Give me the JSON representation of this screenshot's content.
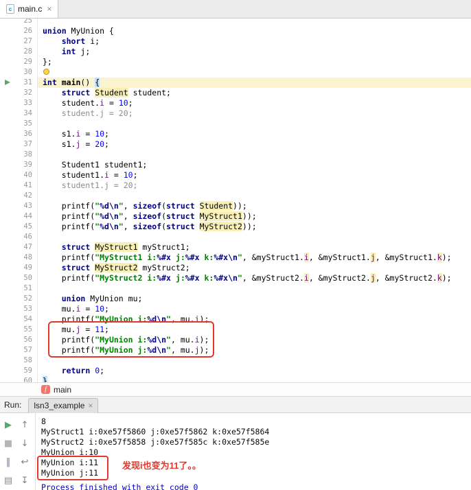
{
  "editor_tab": {
    "title": "main.c",
    "close": "×",
    "icon_letter": "c"
  },
  "breadcrumb": {
    "icon_letter": "f",
    "label": "main"
  },
  "colors": {
    "keyword": "#000080",
    "string": "#008000",
    "number": "#0000FF",
    "field": "#660E7A",
    "identifier_highlight": "#F7EFB6",
    "current_line": "#FCF3CF",
    "annotation_red": "#E3362C",
    "process_line_blue": "#0000CC",
    "run_green": "#59A869"
  },
  "editor": {
    "lines": [
      {
        "n": 25,
        "tokens": []
      },
      {
        "n": 26,
        "tokens": [
          [
            "k",
            "union"
          ],
          [
            "p",
            " MyUnion {"
          ]
        ]
      },
      {
        "n": 27,
        "tokens": [
          [
            "p",
            "    "
          ],
          [
            "k",
            "short"
          ],
          [
            "p",
            " i;"
          ]
        ]
      },
      {
        "n": 28,
        "tokens": [
          [
            "p",
            "    "
          ],
          [
            "k",
            "int"
          ],
          [
            "p",
            " j;"
          ]
        ]
      },
      {
        "n": 29,
        "tokens": [
          [
            "p",
            "};"
          ]
        ]
      },
      {
        "n": 30,
        "tokens": [],
        "bulb": true
      },
      {
        "n": 31,
        "tokens": [
          [
            "k",
            "int"
          ],
          [
            "p",
            " "
          ],
          [
            "b",
            "main"
          ],
          [
            "p",
            "() "
          ],
          [
            "br",
            "{"
          ]
        ],
        "current": true,
        "marker": "run"
      },
      {
        "n": 32,
        "tokens": [
          [
            "p",
            "    "
          ],
          [
            "k",
            "struct"
          ],
          [
            "p",
            " "
          ],
          [
            "t",
            "Student"
          ],
          [
            "p",
            " student;"
          ]
        ]
      },
      {
        "n": 33,
        "tokens": [
          [
            "p",
            "    student."
          ],
          [
            "m",
            "i"
          ],
          [
            "p",
            " = "
          ],
          [
            "nu",
            "10"
          ],
          [
            "p",
            ";"
          ]
        ]
      },
      {
        "n": 34,
        "tokens": [
          [
            "g",
            "    student.j = 20;"
          ]
        ]
      },
      {
        "n": 35,
        "tokens": []
      },
      {
        "n": 36,
        "tokens": [
          [
            "p",
            "    s1."
          ],
          [
            "m",
            "i"
          ],
          [
            "p",
            " = "
          ],
          [
            "nu",
            "10"
          ],
          [
            "p",
            ";"
          ]
        ]
      },
      {
        "n": 37,
        "tokens": [
          [
            "p",
            "    s1."
          ],
          [
            "m",
            "j"
          ],
          [
            "p",
            " = "
          ],
          [
            "nu",
            "20"
          ],
          [
            "p",
            ";"
          ]
        ]
      },
      {
        "n": 38,
        "tokens": []
      },
      {
        "n": 39,
        "tokens": [
          [
            "p",
            "    Student1 student1;"
          ]
        ]
      },
      {
        "n": 40,
        "tokens": [
          [
            "p",
            "    student1."
          ],
          [
            "m",
            "i"
          ],
          [
            "p",
            " = "
          ],
          [
            "nu",
            "10"
          ],
          [
            "p",
            ";"
          ]
        ]
      },
      {
        "n": 41,
        "tokens": [
          [
            "g",
            "    student1.j = 20;"
          ]
        ]
      },
      {
        "n": 42,
        "tokens": []
      },
      {
        "n": 43,
        "tokens": [
          [
            "p",
            "    printf("
          ],
          [
            "s",
            "\""
          ],
          [
            "f",
            "%d\\n"
          ],
          [
            "s",
            "\""
          ],
          [
            "p",
            ", "
          ],
          [
            "k",
            "sizeof"
          ],
          [
            "p",
            "("
          ],
          [
            "k",
            "struct"
          ],
          [
            "p",
            " "
          ],
          [
            "t",
            "Student"
          ],
          [
            "p",
            "));"
          ]
        ]
      },
      {
        "n": 44,
        "tokens": [
          [
            "p",
            "    printf("
          ],
          [
            "s",
            "\""
          ],
          [
            "f",
            "%d\\n"
          ],
          [
            "s",
            "\""
          ],
          [
            "p",
            ", "
          ],
          [
            "k",
            "sizeof"
          ],
          [
            "p",
            "("
          ],
          [
            "k",
            "struct"
          ],
          [
            "p",
            " "
          ],
          [
            "t",
            "MyStruct1"
          ],
          [
            "p",
            "));"
          ]
        ]
      },
      {
        "n": 45,
        "tokens": [
          [
            "p",
            "    printf("
          ],
          [
            "s",
            "\""
          ],
          [
            "f",
            "%d\\n"
          ],
          [
            "s",
            "\""
          ],
          [
            "p",
            ", "
          ],
          [
            "k",
            "sizeof"
          ],
          [
            "p",
            "("
          ],
          [
            "k",
            "struct"
          ],
          [
            "p",
            " "
          ],
          [
            "t",
            "MyStruct2"
          ],
          [
            "p",
            "));"
          ]
        ]
      },
      {
        "n": 46,
        "tokens": []
      },
      {
        "n": 47,
        "tokens": [
          [
            "p",
            "    "
          ],
          [
            "k",
            "struct"
          ],
          [
            "p",
            " "
          ],
          [
            "t",
            "MyStruct1"
          ],
          [
            "p",
            " myStruct1;"
          ]
        ]
      },
      {
        "n": 48,
        "tokens": [
          [
            "p",
            "    printf("
          ],
          [
            "s",
            "\"MyStruct1 i:"
          ],
          [
            "f",
            "%#x"
          ],
          [
            "s",
            " j:"
          ],
          [
            "f",
            "%#x"
          ],
          [
            "s",
            " k:"
          ],
          [
            "f",
            "%#x\\n"
          ],
          [
            "s",
            "\""
          ],
          [
            "p",
            ", &myStruct1."
          ],
          [
            "mh",
            "i"
          ],
          [
            "p",
            ", &myStruct1."
          ],
          [
            "mh",
            "j"
          ],
          [
            "p",
            ", &myStruct1."
          ],
          [
            "mh",
            "k"
          ],
          [
            "p",
            ");"
          ]
        ]
      },
      {
        "n": 49,
        "tokens": [
          [
            "p",
            "    "
          ],
          [
            "k",
            "struct"
          ],
          [
            "p",
            " "
          ],
          [
            "t",
            "MyStruct2"
          ],
          [
            "p",
            " myStruct2;"
          ]
        ]
      },
      {
        "n": 50,
        "tokens": [
          [
            "p",
            "    printf("
          ],
          [
            "s",
            "\"MyStruct2 i:"
          ],
          [
            "f",
            "%#x"
          ],
          [
            "s",
            " j:"
          ],
          [
            "f",
            "%#x"
          ],
          [
            "s",
            " k:"
          ],
          [
            "f",
            "%#x\\n"
          ],
          [
            "s",
            "\""
          ],
          [
            "p",
            ", &myStruct2."
          ],
          [
            "mh",
            "i"
          ],
          [
            "p",
            ", &myStruct2."
          ],
          [
            "mh",
            "j"
          ],
          [
            "p",
            ", &myStruct2."
          ],
          [
            "mh",
            "k"
          ],
          [
            "p",
            ");"
          ]
        ]
      },
      {
        "n": 51,
        "tokens": []
      },
      {
        "n": 52,
        "tokens": [
          [
            "p",
            "    "
          ],
          [
            "k",
            "union"
          ],
          [
            "p",
            " MyUnion mu;"
          ]
        ]
      },
      {
        "n": 53,
        "tokens": [
          [
            "p",
            "    mu."
          ],
          [
            "m",
            "i"
          ],
          [
            "p",
            " = "
          ],
          [
            "nu",
            "10"
          ],
          [
            "p",
            ";"
          ]
        ]
      },
      {
        "n": 54,
        "tokens": [
          [
            "p",
            "    printf("
          ],
          [
            "s",
            "\"MyUnion i:"
          ],
          [
            "f",
            "%d\\n"
          ],
          [
            "s",
            "\""
          ],
          [
            "p",
            ", mu."
          ],
          [
            "m",
            "i"
          ],
          [
            "p",
            ");"
          ]
        ]
      },
      {
        "n": 55,
        "tokens": [
          [
            "p",
            "    mu."
          ],
          [
            "m",
            "j"
          ],
          [
            "p",
            " = "
          ],
          [
            "nu",
            "11"
          ],
          [
            "p",
            ";"
          ]
        ]
      },
      {
        "n": 56,
        "tokens": [
          [
            "p",
            "    printf("
          ],
          [
            "s",
            "\"MyUnion i:"
          ],
          [
            "f",
            "%d\\n"
          ],
          [
            "s",
            "\""
          ],
          [
            "p",
            ", mu."
          ],
          [
            "m",
            "i"
          ],
          [
            "p",
            ");"
          ]
        ]
      },
      {
        "n": 57,
        "tokens": [
          [
            "p",
            "    printf("
          ],
          [
            "s",
            "\"MyUnion j:"
          ],
          [
            "f",
            "%d\\n"
          ],
          [
            "s",
            "\""
          ],
          [
            "p",
            ", mu."
          ],
          [
            "m",
            "j"
          ],
          [
            "p",
            ");"
          ]
        ]
      },
      {
        "n": 58,
        "tokens": []
      },
      {
        "n": 59,
        "tokens": [
          [
            "p",
            "    "
          ],
          [
            "k",
            "return"
          ],
          [
            "p",
            " "
          ],
          [
            "nu",
            "0"
          ],
          [
            "p",
            ";"
          ]
        ]
      },
      {
        "n": 60,
        "tokens": [
          [
            "br",
            "}"
          ]
        ]
      }
    ]
  },
  "run": {
    "label": "Run:",
    "tab_title": "lsn3_example",
    "tab_close": "×",
    "console_lines": [
      "8",
      "MyStruct1 i:0xe57f5860 j:0xe57f5862 k:0xe57f5864",
      "MyStruct2 i:0xe57f5858 j:0xe57f585c k:0xe57f585e",
      "MyUnion i:10",
      "MyUnion i:11",
      "MyUnion j:11"
    ],
    "process_line": "Process finished with exit code 0",
    "note": "发现i也变为11了。。",
    "toolbar": [
      {
        "name": "rerun-button",
        "glyph": "▶",
        "color": "#59A869"
      },
      {
        "name": "up-stack-button",
        "glyph": "↑",
        "color": "#7F7F7F"
      },
      {
        "name": "stop-button",
        "glyph": "■",
        "color": "#B5B5B5"
      },
      {
        "name": "down-stack-button",
        "glyph": "↓",
        "color": "#7F7F7F"
      },
      {
        "name": "pause-output-button",
        "glyph": "‖",
        "color": "#6E7E99"
      },
      {
        "name": "soft-wrap-button",
        "glyph": "↩",
        "color": "#7F7F7F"
      },
      {
        "name": "clear-all-button",
        "glyph": "▤",
        "color": "#8A8A8A"
      },
      {
        "name": "scroll-to-end-button",
        "glyph": "↧",
        "color": "#7F7F7F"
      }
    ]
  }
}
